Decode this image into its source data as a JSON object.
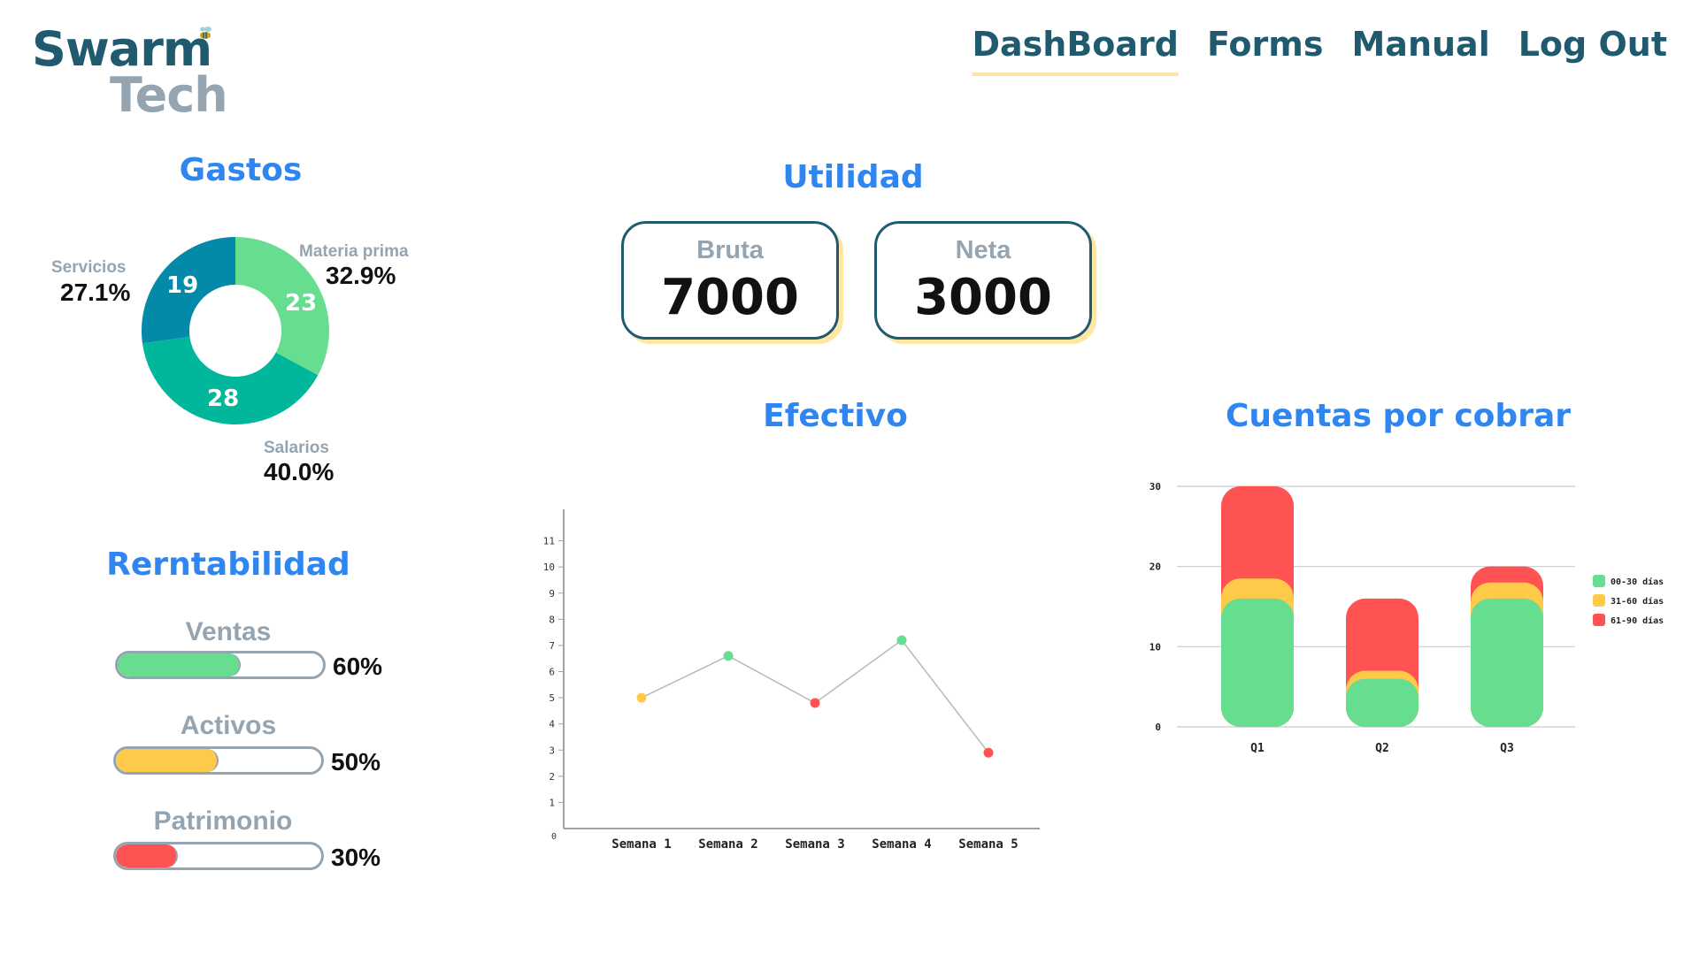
{
  "logo": {
    "line1": "Swarm",
    "line2": "Tech"
  },
  "nav": {
    "items": [
      "DashBoard",
      "Forms",
      "Manual",
      "Log Out"
    ],
    "active": "DashBoard"
  },
  "gastos": {
    "title": "Gastos",
    "slices": [
      {
        "name": "Materia prima",
        "value": 23,
        "pct": "32.9%",
        "color": "#66dd8f"
      },
      {
        "name": "Salarios",
        "value": 28,
        "pct": "40.0%",
        "color": "#00b79b"
      },
      {
        "name": "Servicios",
        "value": 19,
        "pct": "27.1%",
        "color": "#038aa8"
      }
    ]
  },
  "utilidad": {
    "title": "Utilidad",
    "bruta": {
      "label": "Bruta",
      "value": "7000"
    },
    "neta": {
      "label": "Neta",
      "value": "3000"
    }
  },
  "rentabilidad": {
    "title": "Rerntabilidad",
    "bars": [
      {
        "label": "Ventas",
        "value": 0.6,
        "pct": "60%",
        "color": "#66dd8f"
      },
      {
        "label": "Activos",
        "value": 0.5,
        "pct": "50%",
        "color": "#ffc94a"
      },
      {
        "label": "Patrimonio",
        "value": 0.3,
        "pct": "30%",
        "color": "#ff5252"
      }
    ]
  },
  "efectivo": {
    "title": "Efectivo",
    "chart_data": {
      "type": "line",
      "categories": [
        "Semana 1",
        "Semana 2",
        "Semana 3",
        "Semana 4",
        "Semana 5"
      ],
      "values": [
        5,
        6.6,
        4.8,
        7.2,
        2.9
      ],
      "point_colors": [
        "#ffc94a",
        "#66dd8f",
        "#ff5252",
        "#66dd8f",
        "#ff5252"
      ],
      "ylim": [
        0,
        12
      ],
      "yticks": [
        "0",
        "1",
        "2",
        "3",
        "4",
        "5",
        "6",
        "7",
        "8",
        "9",
        "10",
        "11"
      ],
      "grid": false
    }
  },
  "cuentas": {
    "title": "Cuentas por cobrar",
    "chart_data": {
      "type": "bar",
      "stacked": true,
      "categories": [
        "Q1",
        "Q2",
        "Q3"
      ],
      "series": [
        {
          "name": "00-30 días",
          "color": "#66dd8f",
          "values": [
            16,
            6,
            16
          ]
        },
        {
          "name": "31-60 días",
          "color": "#ffc94a",
          "values": [
            2.5,
            1,
            2
          ]
        },
        {
          "name": "61-90 días",
          "color": "#ff5252",
          "values": [
            11.5,
            9,
            2
          ]
        }
      ],
      "ylim": [
        0,
        30
      ],
      "yticks": [
        "0",
        "10",
        "20",
        "30"
      ],
      "grid": true,
      "legend": "right"
    }
  }
}
